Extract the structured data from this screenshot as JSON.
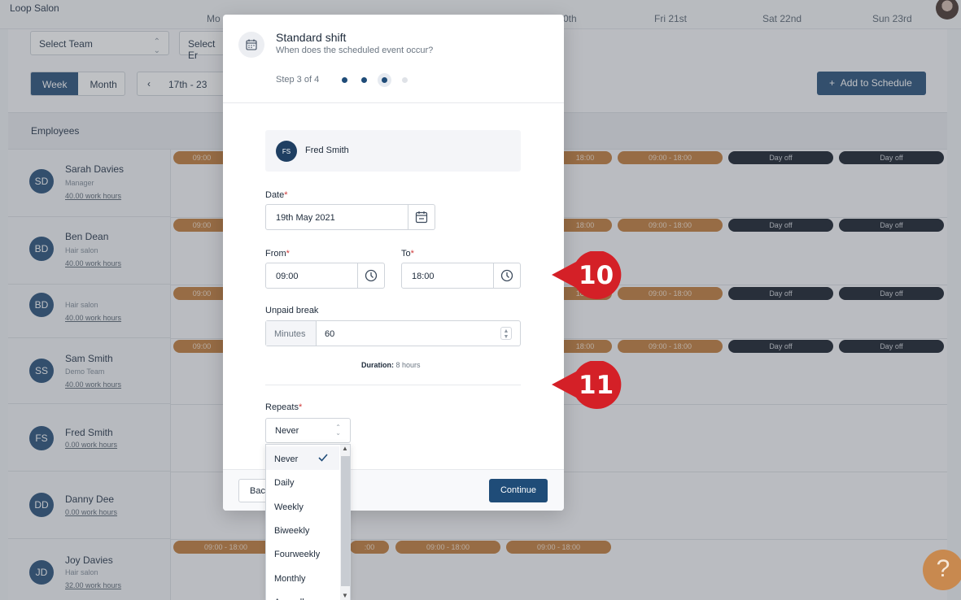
{
  "app": {
    "title": "Loop Salon",
    "select_team": "Select Team",
    "select_employee": "Select Er",
    "view_week": "Week",
    "view_month": "Month",
    "date_range": "17th - 23",
    "add_to_schedule": "Add to Schedule",
    "employees_header": "Employees",
    "day_headers": [
      "Mo",
      "0th",
      "Fri 21st",
      "Sat 22nd",
      "Sun 23rd"
    ]
  },
  "employees": [
    {
      "initials": "SD",
      "name": "Sarah Davies",
      "role": "Manager",
      "hours": "40.00 work hours"
    },
    {
      "initials": "BD",
      "name": "Ben Dean",
      "role": "Hair salon",
      "hours": "40.00 work hours"
    },
    {
      "initials": "BD",
      "name": "",
      "role": "Hair salon",
      "hours": "40.00 work hours"
    },
    {
      "initials": "SS",
      "name": "Sam Smith",
      "role": "Demo Team",
      "hours": "40.00 work hours"
    },
    {
      "initials": "FS",
      "name": "Fred Smith",
      "role": "",
      "hours": "0.00 work hours"
    },
    {
      "initials": "DD",
      "name": "Danny Dee",
      "role": "",
      "hours": "0.00 work hours"
    },
    {
      "initials": "JD",
      "name": "Joy Davies",
      "role": "Hair salon",
      "hours": "32.00 work hours"
    }
  ],
  "shifts": {
    "partial": "09:00",
    "partial_end": "18:00",
    "full": "09:00 - 18:00",
    "tail": ":00",
    "day_off": "Day off"
  },
  "modal": {
    "title": "Standard shift",
    "subtitle": "When does the scheduled event occur?",
    "step": "Step 3 of 4",
    "steps_total": 4,
    "current_step": 3,
    "employee": {
      "initials": "FS",
      "name": "Fred Smith"
    },
    "date_label": "Date",
    "date_value": "19th May 2021",
    "from_label": "From",
    "from_value": "09:00",
    "to_label": "To",
    "to_value": "18:00",
    "break_label": "Unpaid break",
    "break_prefix": "Minutes",
    "break_value": "60",
    "duration_label": "Duration:",
    "duration_value": "8 hours",
    "repeats_label": "Repeats",
    "repeats_value": "Never",
    "required_mark": "*",
    "back": "Back",
    "continue": "Continue"
  },
  "repeat_options": [
    "Never",
    "Daily",
    "Weekly",
    "Biweekly",
    "Fourweekly",
    "Monthly",
    "Annually"
  ],
  "callouts": [
    "10",
    "11"
  ],
  "help": "?",
  "colors": {
    "primary": "#1f4c78",
    "shift": "#c8894f",
    "day_off": "#2f3540",
    "callout": "#d42027"
  }
}
